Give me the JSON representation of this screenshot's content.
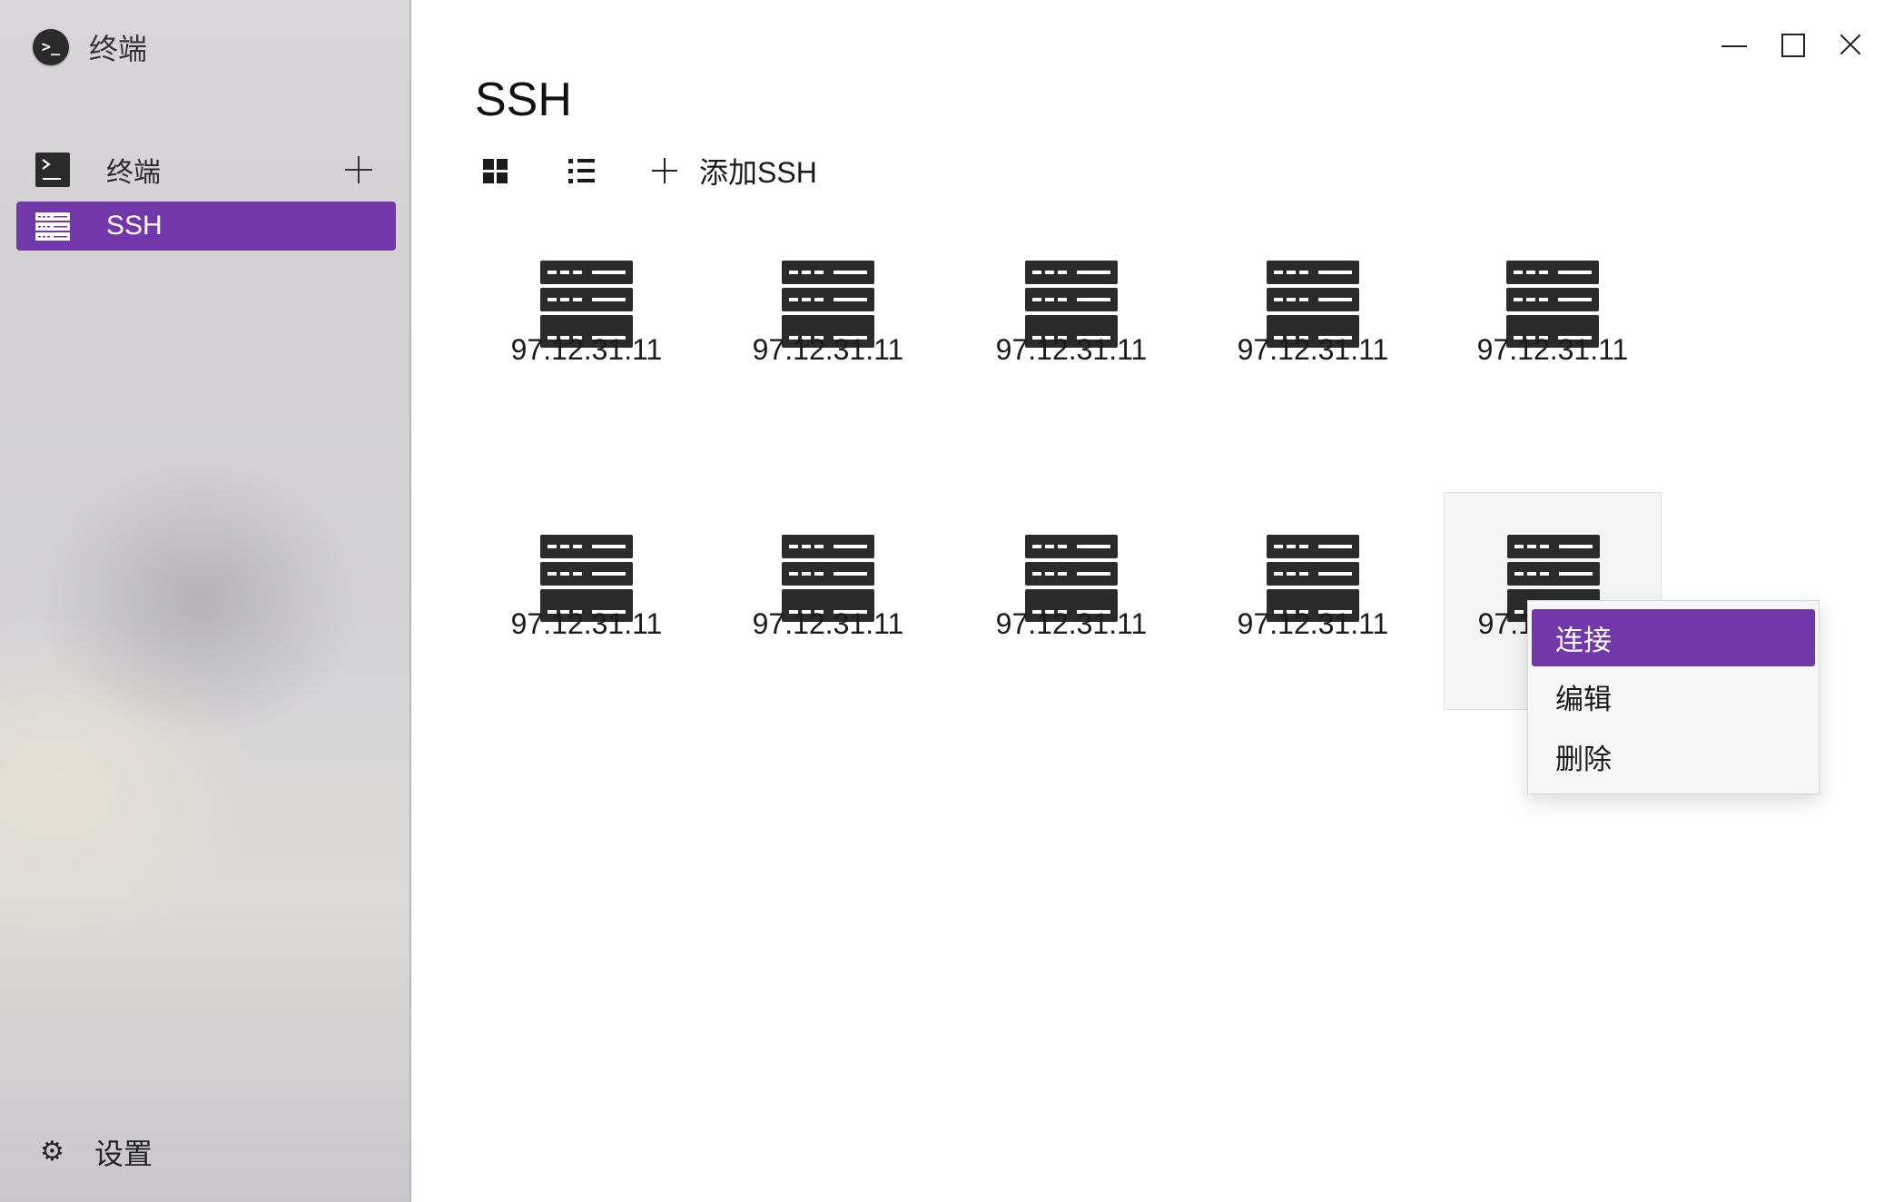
{
  "app": {
    "title": "终端",
    "logo_glyph": ">_"
  },
  "sidebar": {
    "items": [
      {
        "label": "终端",
        "icon": "terminal-icon",
        "has_add_button": true
      },
      {
        "label": "SSH",
        "icon": "server-icon",
        "selected": true
      }
    ],
    "settings_label": "设置"
  },
  "window_controls": [
    "minimize",
    "maximize",
    "close"
  ],
  "main": {
    "title": "SSH",
    "toolbar": {
      "grid_view_icon": "grid-view-icon",
      "list_view_icon": "list-view-icon",
      "add_label": "添加SSH"
    },
    "hosts": [
      {
        "label": "97.12.31.11"
      },
      {
        "label": "97.12.31.11"
      },
      {
        "label": "97.12.31.11"
      },
      {
        "label": "97.12.31.11"
      },
      {
        "label": "97.12.31.11"
      },
      {
        "label": "97.12.31.11"
      },
      {
        "label": "97.12.31.11"
      },
      {
        "label": "97.12.31.11"
      },
      {
        "label": "97.12.31.11"
      },
      {
        "label": "97.12.31.11",
        "selected": true
      }
    ]
  },
  "context_menu": {
    "items": [
      {
        "label": "连接",
        "active": true
      },
      {
        "label": "编辑"
      },
      {
        "label": "删除"
      }
    ]
  },
  "colors": {
    "accent": "#7238a9",
    "icon_dark": "#2b2b2b"
  }
}
